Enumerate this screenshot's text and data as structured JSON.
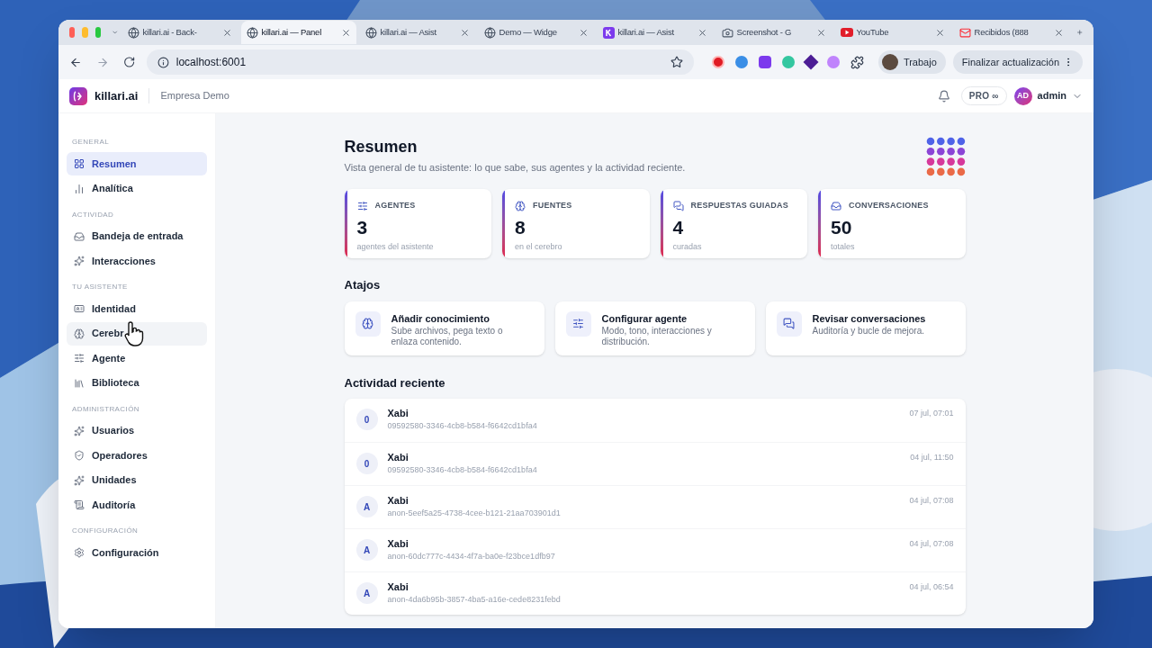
{
  "browser": {
    "tabs": [
      {
        "title": "killari.ai - Back-",
        "kind": "globe",
        "selected": false
      },
      {
        "title": "killari.ai — Panel",
        "kind": "globe",
        "selected": true
      },
      {
        "title": "killari.ai — Asist",
        "kind": "globe",
        "selected": false
      },
      {
        "title": "Demo — Widge",
        "kind": "globe",
        "selected": false
      },
      {
        "title": "killari.ai — Asist",
        "kind": "brand",
        "selected": false
      },
      {
        "title": "Screenshot - G",
        "kind": "camera",
        "selected": false
      },
      {
        "title": "YouTube",
        "kind": "video",
        "selected": false
      },
      {
        "title": "Recibidos (888",
        "kind": "mail",
        "selected": false
      }
    ],
    "url": "localhost:6001",
    "profile": "Trabajo",
    "update_button": "Finalizar actualización"
  },
  "app": {
    "brand": "killari.ai",
    "organization": "Empresa Demo",
    "plan": "PRO ∞",
    "user_initials": "AD",
    "user_name": "admin"
  },
  "sidebar": [
    {
      "title": "GENERAL",
      "items": [
        {
          "label": "Resumen",
          "selected": true,
          "hovered": false
        },
        {
          "label": "Analítica",
          "selected": false,
          "hovered": false
        }
      ]
    },
    {
      "title": "ACTIVIDAD",
      "items": [
        {
          "label": "Bandeja de entrada",
          "selected": false,
          "hovered": false
        },
        {
          "label": "Interacciones",
          "selected": false,
          "hovered": false
        }
      ]
    },
    {
      "title": "TU ASISTENTE",
      "items": [
        {
          "label": "Identidad",
          "selected": false,
          "hovered": false
        },
        {
          "label": "Cerebr",
          "selected": false,
          "hovered": true
        },
        {
          "label": "Agente",
          "selected": false,
          "hovered": false
        },
        {
          "label": "Biblioteca",
          "selected": false,
          "hovered": false
        }
      ]
    },
    {
      "title": "ADMINISTRACIÓN",
      "items": [
        {
          "label": "Usuarios",
          "selected": false,
          "hovered": false
        },
        {
          "label": "Operadores",
          "selected": false,
          "hovered": false
        },
        {
          "label": "Unidades",
          "selected": false,
          "hovered": false
        },
        {
          "label": "Auditoría",
          "selected": false,
          "hovered": false
        }
      ]
    },
    {
      "title": "CONFIGURACIÓN",
      "items": [
        {
          "label": "Configuración",
          "selected": false,
          "hovered": false
        }
      ]
    }
  ],
  "page": {
    "title": "Resumen",
    "subtitle": "Vista general de tu asistente: lo que sabe, sus agentes y la actividad reciente.",
    "stats": [
      {
        "label": "AGENTES",
        "value": "3",
        "caption": "agentes del asistente"
      },
      {
        "label": "FUENTES",
        "value": "8",
        "caption": "en el cerebro"
      },
      {
        "label": "RESPUESTAS GUIADAS",
        "value": "4",
        "caption": "curadas"
      },
      {
        "label": "CONVERSACIONES",
        "value": "50",
        "caption": "totales"
      }
    ],
    "shortcuts_title": "Atajos",
    "shortcuts": [
      {
        "title": "Añadir conocimiento",
        "description": "Sube archivos, pega texto o enlaza contenido."
      },
      {
        "title": "Configurar agente",
        "description": "Modo, tono, interacciones y distribución."
      },
      {
        "title": "Revisar conversaciones",
        "description": "Auditoría y bucle de mejora."
      }
    ],
    "activity_title": "Actividad reciente",
    "activity": [
      {
        "initial": "0",
        "name": "Xabi",
        "id": "09592580-3346-4cb8-b584-f6642cd1bfa4",
        "time": "07 jul, 07:01"
      },
      {
        "initial": "0",
        "name": "Xabi",
        "id": "09592580-3346-4cb8-b584-f6642cd1bfa4",
        "time": "04 jul, 11:50"
      },
      {
        "initial": "A",
        "name": "Xabi",
        "id": "anon-5eef5a25-4738-4cee-b121-21aa703901d1",
        "time": "04 jul, 07:08"
      },
      {
        "initial": "A",
        "name": "Xabi",
        "id": "anon-60dc777c-4434-4f7a-ba0e-f23bce1dfb97",
        "time": "04 jul, 07:08"
      },
      {
        "initial": "A",
        "name": "Xabi",
        "id": "anon-4da6b95b-3857-4ba5-a16e-cede8231febd",
        "time": "04 jul, 06:54"
      }
    ]
  }
}
